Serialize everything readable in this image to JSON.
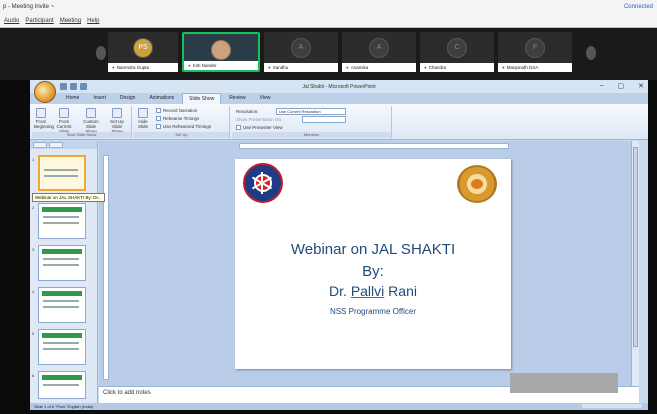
{
  "meeting": {
    "title": "p - Meeting Invite ~",
    "status_right": "Connected",
    "menu": [
      "Audio",
      "Participant",
      "Meeting",
      "Help"
    ]
  },
  "participants": [
    {
      "name": "",
      "initial": "PS",
      "active": false
    },
    {
      "name": "Narendra Gupta",
      "initial": "",
      "active": false
    },
    {
      "name": "Kirti Nander",
      "initial": "",
      "active": true
    },
    {
      "name": "Sandhu",
      "initial": "A",
      "active": false
    },
    {
      "name": "Anamika",
      "initial": "A",
      "active": false
    },
    {
      "name": "Chandra",
      "initial": "C",
      "active": false
    },
    {
      "name": "Manjunath DSA",
      "initial": "F",
      "active": false
    }
  ],
  "powerpoint": {
    "window_title": "Jal Shakti - Microsoft PowerPoint",
    "window_controls": [
      "–",
      "▢",
      "✕"
    ],
    "tabs": [
      "Home",
      "Insert",
      "Design",
      "Animations",
      "Slide Show",
      "Review",
      "View"
    ],
    "selected_tab": "Slide Show",
    "ribbon": {
      "buttons": [
        "From Beginning",
        "From Current Slide",
        "Custom Slide Show",
        "Set Up Slide Show",
        "Hide Slide"
      ],
      "options": [
        "Record Narration",
        "Rehearse Timings",
        "Use Rehearsed Timings"
      ],
      "resolution_label": "Resolution:",
      "resolution_value": "Use Current Resolution",
      "show_on_label": "Show Presentation On:",
      "presenter_view": "Use Presenter View",
      "groups": [
        "Start Slide Show",
        "Set Up",
        "Monitors"
      ]
    },
    "slide_tooltip": "Webinar on JAL SHAKTI By: Dr...",
    "slide_numbers": [
      "1",
      "2",
      "3",
      "4",
      "5",
      "6"
    ],
    "slide": {
      "title": "Webinar on JAL SHAKTI",
      "by": "By:",
      "name_prefix": "Dr. ",
      "name_underlined": "Pallvi",
      "name_suffix": " Rani",
      "role": "NSS Programme Officer"
    },
    "notes_placeholder": "Click to add notes",
    "status_text": "Slide 1 of 6   \"Flow\"   English (India)"
  }
}
